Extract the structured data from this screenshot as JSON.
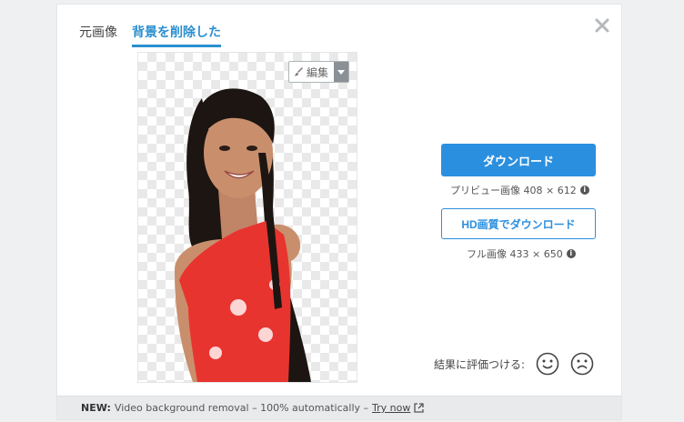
{
  "tabs": [
    {
      "label": "元画像",
      "active": false
    },
    {
      "label": "背景を削除した",
      "active": true
    }
  ],
  "preview": {
    "edit_label": "編集"
  },
  "download": {
    "button_label": "ダウンロード",
    "info_text": "プリビュー画像 408 × 612",
    "hd_button_label": "HD画質でダウンロード",
    "hd_info_text": "フル画像 433 × 650"
  },
  "rating": {
    "label": "結果に評価つける:"
  },
  "banner": {
    "prefix": "NEW:",
    "text": "Video background removal – 100% automatically –",
    "link": "Try now"
  },
  "colors": {
    "accent": "#2b8fdf",
    "dress_red": "#e8342f",
    "hair": "#1c1512",
    "skin": "#c98f6d"
  },
  "icons": [
    "close-icon",
    "brush-icon",
    "chevron-down-icon",
    "info-icon",
    "smile-icon",
    "frown-icon",
    "external-link-icon"
  ]
}
